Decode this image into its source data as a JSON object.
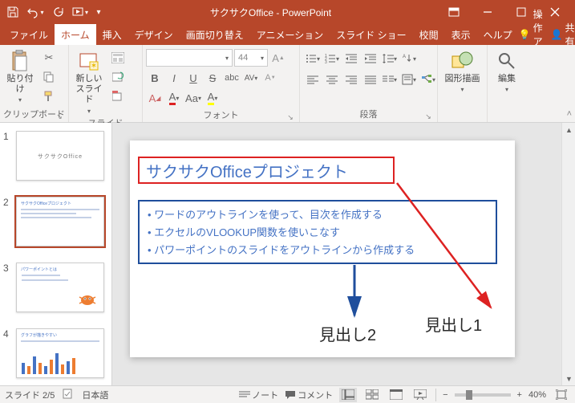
{
  "titlebar": {
    "title": "サクサクOffice - PowerPoint"
  },
  "tabs": {
    "file": "ファイル",
    "home": "ホーム",
    "insert": "挿入",
    "design": "デザイン",
    "transitions": "画面切り替え",
    "animations": "アニメーション",
    "slideshow": "スライド ショー",
    "review": "校閲",
    "view": "表示",
    "help": "ヘルプ",
    "tellme": "操作アシ",
    "share": "共有"
  },
  "ribbon": {
    "clipboard": {
      "label": "クリップボード",
      "paste": "貼り付け"
    },
    "slides": {
      "label": "スライド",
      "newslide": "新しい\nスライド"
    },
    "font": {
      "label": "フォント",
      "size": "44"
    },
    "paragraph": {
      "label": "段落"
    },
    "drawing": {
      "label": "図形描画"
    },
    "editing": {
      "label": "編集"
    }
  },
  "thumbnails": [
    {
      "num": "1"
    },
    {
      "num": "2"
    },
    {
      "num": "3"
    },
    {
      "num": "4"
    }
  ],
  "slide": {
    "title": "サクサクOfficeプロジェクト",
    "bullets": [
      "ワードのアウトラインを使って、目次を作成する",
      "エクセルのVLOOKUP関数を使いこなす",
      "パワーポイントのスライドをアウトラインから作成する"
    ]
  },
  "annotations": {
    "h1": "見出し1",
    "h2": "見出し2"
  },
  "statusbar": {
    "slide": "スライド 2/5",
    "lang": "日本語",
    "notes": "ノート",
    "comments": "コメント",
    "zoom": "40%"
  }
}
